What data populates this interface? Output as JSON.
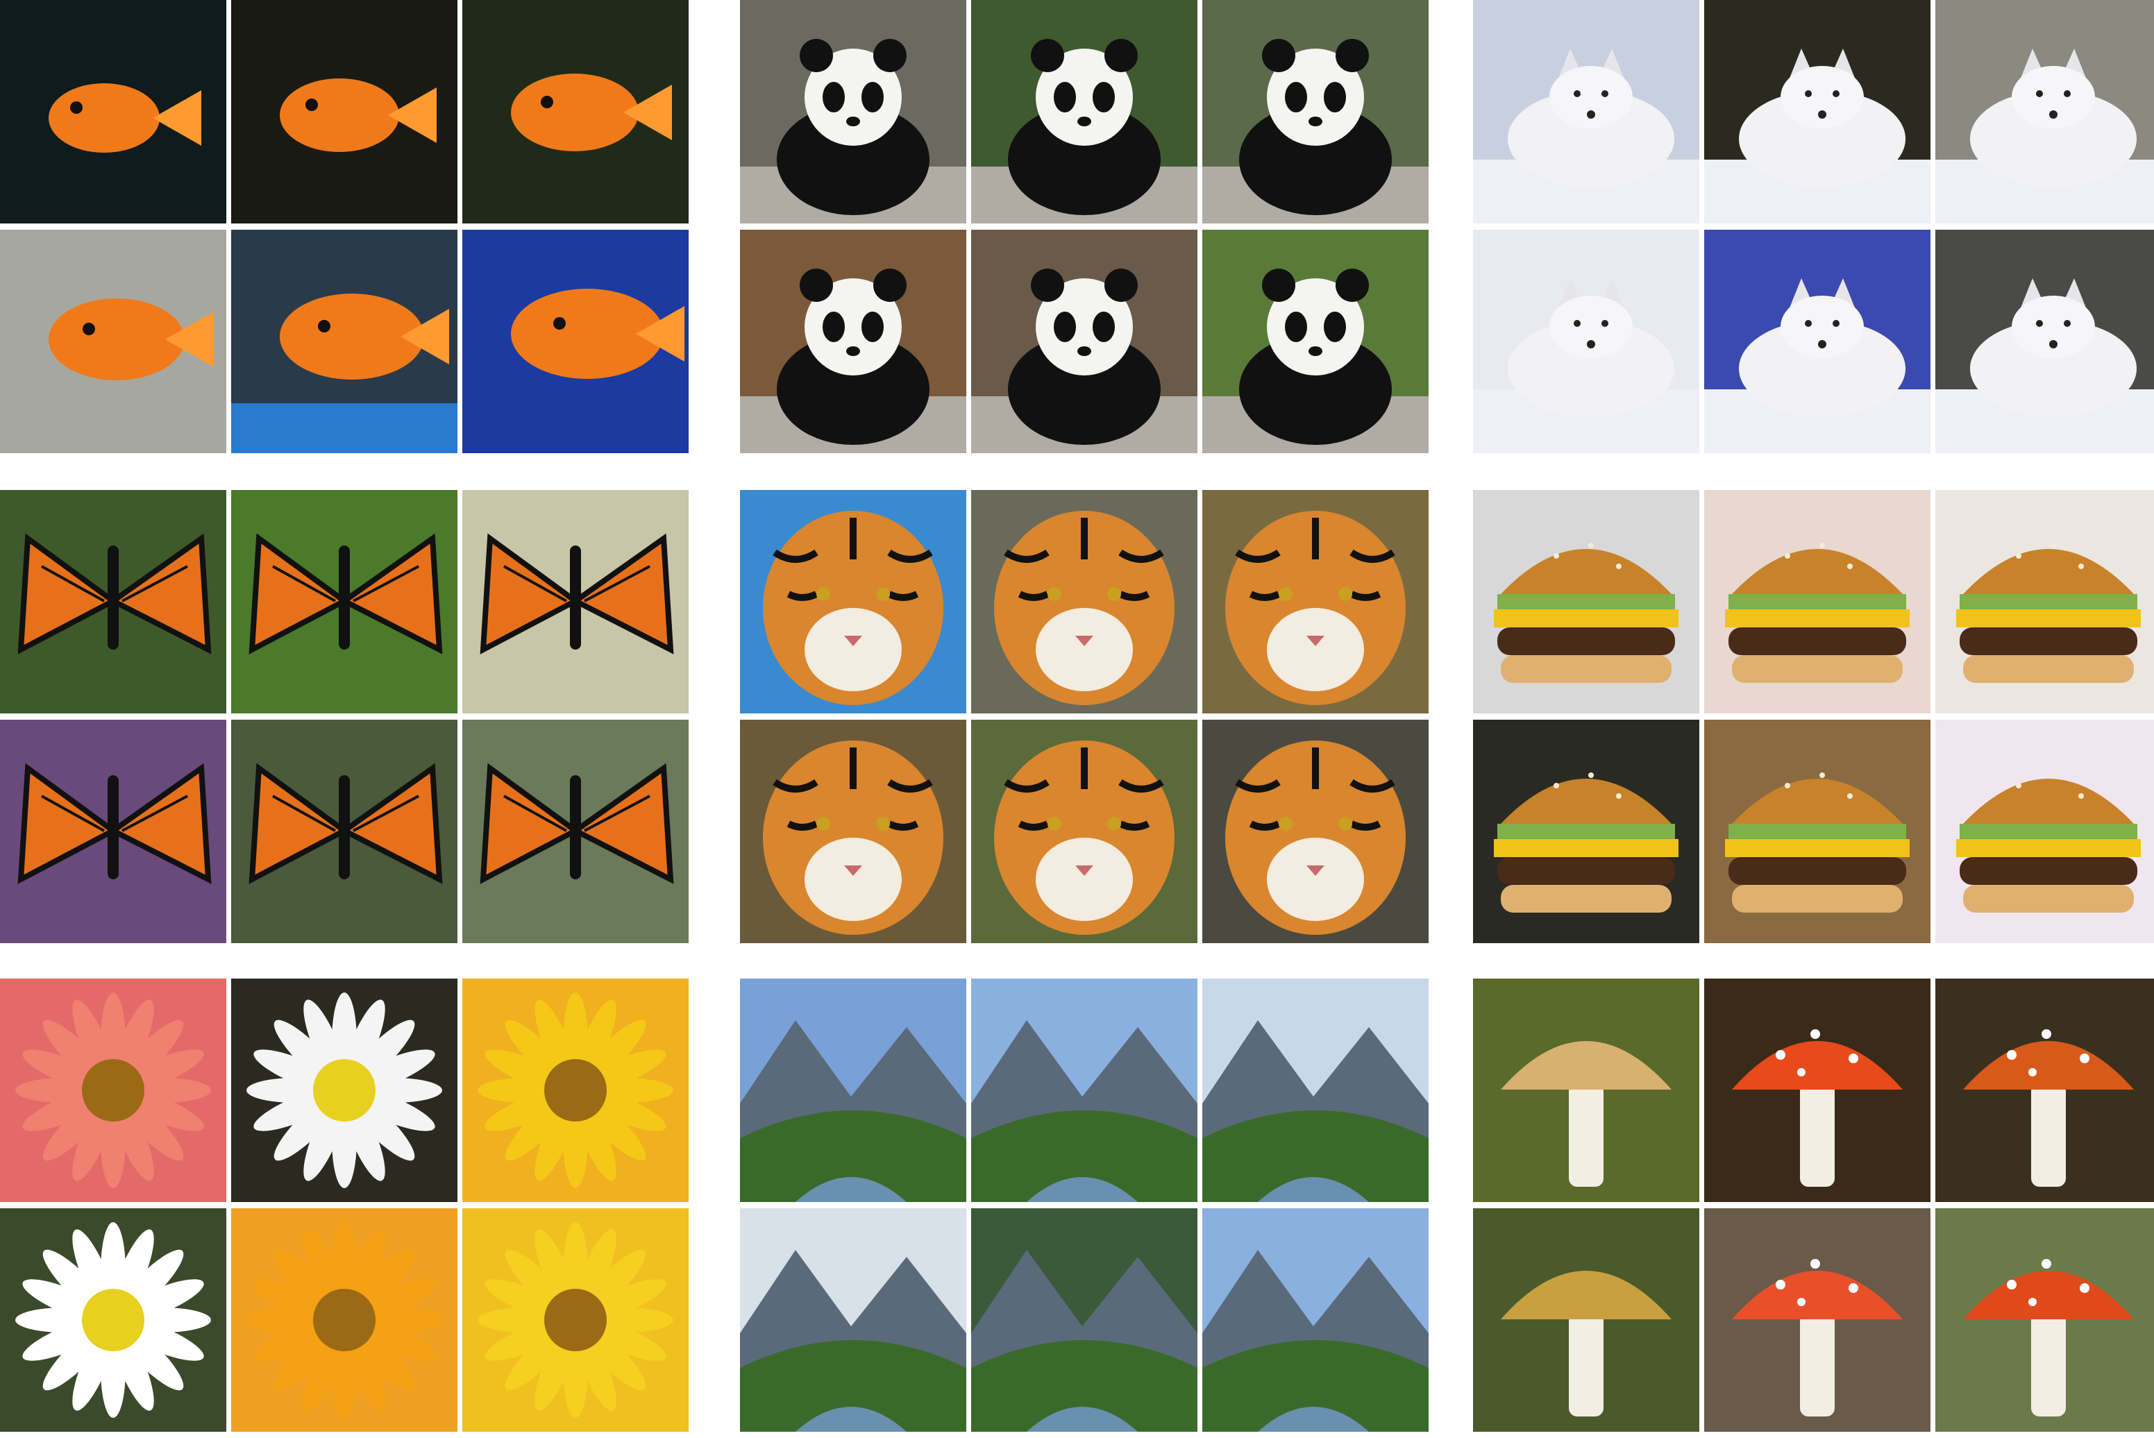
{
  "image": {
    "kind": "sample-grid",
    "groups": [
      {
        "subject": "goldfish",
        "tiles": [
          "goldfish-1",
          "goldfish-2",
          "goldfish-3",
          "goldfish-4",
          "goldfish-5",
          "goldfish-6"
        ]
      },
      {
        "subject": "panda",
        "tiles": [
          "panda-1",
          "panda-2",
          "panda-3",
          "panda-4",
          "panda-5",
          "panda-6"
        ]
      },
      {
        "subject": "arctic-fox",
        "tiles": [
          "fox-1",
          "fox-2",
          "fox-3",
          "fox-4",
          "fox-5",
          "fox-6"
        ]
      },
      {
        "subject": "monarch-butterfly",
        "tiles": [
          "butterfly-1",
          "butterfly-2",
          "butterfly-3",
          "butterfly-4",
          "butterfly-5",
          "butterfly-6"
        ]
      },
      {
        "subject": "tiger",
        "tiles": [
          "tiger-1",
          "tiger-2",
          "tiger-3",
          "tiger-4",
          "tiger-5",
          "tiger-6"
        ]
      },
      {
        "subject": "cheeseburger",
        "tiles": [
          "burger-1",
          "burger-2",
          "burger-3",
          "burger-4",
          "burger-5",
          "burger-6"
        ]
      },
      {
        "subject": "daisy-flower",
        "tiles": [
          "flower-1",
          "flower-2",
          "flower-3",
          "flower-4",
          "flower-5",
          "flower-6"
        ]
      },
      {
        "subject": "valley-landscape",
        "tiles": [
          "valley-1",
          "valley-2",
          "valley-3",
          "valley-4",
          "valley-5",
          "valley-6"
        ]
      },
      {
        "subject": "mushroom",
        "tiles": [
          "mushroom-1",
          "mushroom-2",
          "mushroom-3",
          "mushroom-4",
          "mushroom-5",
          "mushroom-6"
        ]
      }
    ]
  }
}
